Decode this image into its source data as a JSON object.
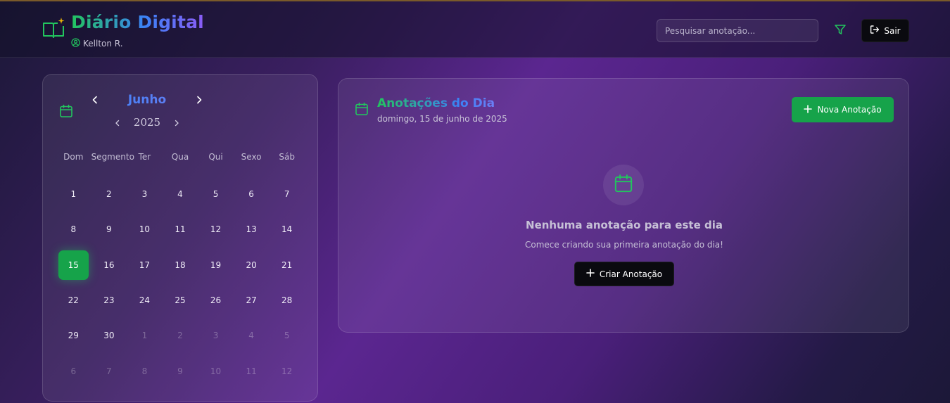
{
  "header": {
    "app_title": "Diário Digital",
    "user_name": "Kellton R.",
    "search_placeholder": "Pesquisar anotação...",
    "logout_label": "Sair"
  },
  "calendar": {
    "month": "Junho",
    "year": "2025",
    "weekdays": [
      "Dom",
      "Segmento",
      "Ter",
      "Qua",
      "Qui",
      "Sexo",
      "Sáb"
    ],
    "days": [
      {
        "label": "1"
      },
      {
        "label": "2"
      },
      {
        "label": "3"
      },
      {
        "label": "4"
      },
      {
        "label": "5"
      },
      {
        "label": "6"
      },
      {
        "label": "7"
      },
      {
        "label": "8"
      },
      {
        "label": "9"
      },
      {
        "label": "10"
      },
      {
        "label": "11"
      },
      {
        "label": "12"
      },
      {
        "label": "13"
      },
      {
        "label": "14"
      },
      {
        "label": "15",
        "selected": true
      },
      {
        "label": "16"
      },
      {
        "label": "17"
      },
      {
        "label": "18"
      },
      {
        "label": "19"
      },
      {
        "label": "20"
      },
      {
        "label": "21"
      },
      {
        "label": "22"
      },
      {
        "label": "23"
      },
      {
        "label": "24"
      },
      {
        "label": "25"
      },
      {
        "label": "26"
      },
      {
        "label": "27"
      },
      {
        "label": "28"
      },
      {
        "label": "29"
      },
      {
        "label": "30"
      },
      {
        "label": "1",
        "muted": true
      },
      {
        "label": "2",
        "muted": true
      },
      {
        "label": "3",
        "muted": true
      },
      {
        "label": "4",
        "muted": true
      },
      {
        "label": "5",
        "muted": true
      },
      {
        "label": "6",
        "muted": true
      },
      {
        "label": "7",
        "muted": true
      },
      {
        "label": "8",
        "muted": true
      },
      {
        "label": "9",
        "muted": true
      },
      {
        "label": "10",
        "muted": true
      },
      {
        "label": "11",
        "muted": true
      },
      {
        "label": "12",
        "muted": true
      }
    ]
  },
  "notes": {
    "title": "Anotações do Dia",
    "date": "domingo, 15 de junho de 2025",
    "new_button_label": "Nova Anotação",
    "empty_title": "Nenhuma anotação para este dia",
    "empty_subtitle": "Comece criando sua primeira anotação do dia!",
    "create_button_label": "Criar Anotação"
  },
  "colors": {
    "accent_green": "#16a34a",
    "accent_blue": "#3b82f6",
    "background_purple": "#5b2690"
  },
  "icons": {
    "logo": "book-sparkle-icon",
    "user": "user-circle-icon",
    "filter": "filter-icon",
    "logout": "logout-icon",
    "calendar": "calendar-icon",
    "plus": "plus-icon"
  }
}
